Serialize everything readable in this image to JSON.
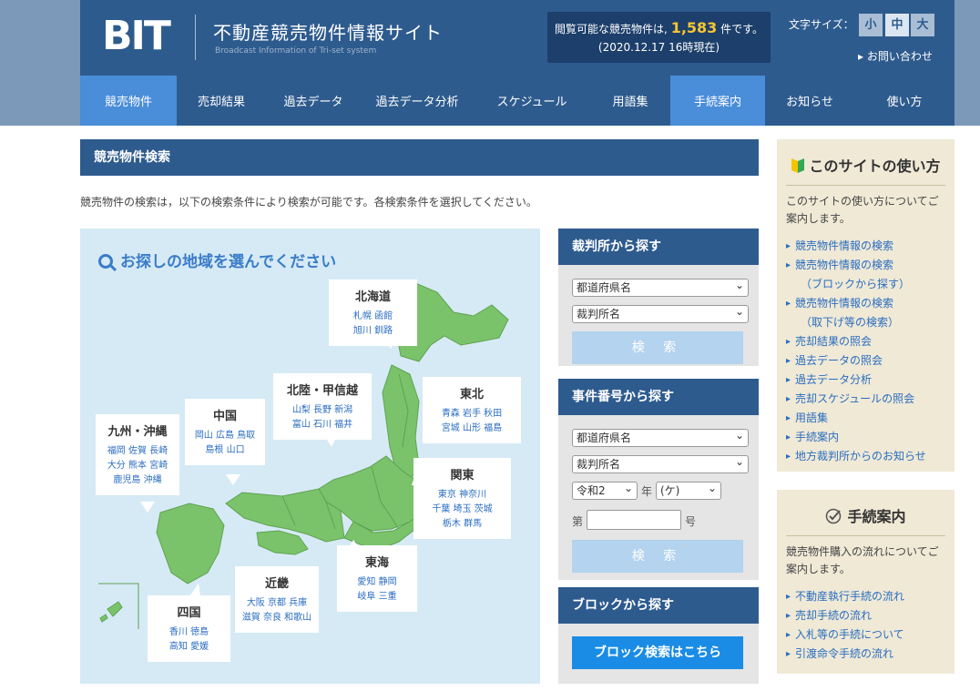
{
  "header": {
    "logo": "BIT",
    "site_title": "不動産競売物件情報サイト",
    "site_subtitle": "Broadcast Information of Tri-set system",
    "count_prefix": "閲覧可能な競売物件は,",
    "count_value": "1,583",
    "count_suffix": "件です。",
    "count_date": "(2020.12.17 16時現在)",
    "font_size_label": "文字サイズ：",
    "font_sizes": [
      "小",
      "中",
      "大"
    ],
    "font_size_selected": "中",
    "contact": "▸ お問い合わせ"
  },
  "nav": {
    "items": [
      "競売物件",
      "売却結果",
      "過去データ",
      "過去データ分析",
      "スケジュール",
      "用語集",
      "手続案内",
      "お知らせ",
      "使い方"
    ],
    "active": [
      "競売物件",
      "手続案内"
    ]
  },
  "main": {
    "section_title": "競売物件検索",
    "intro": "競売物件の検索は，以下の検索条件により検索が可能です。各検索条件を選択してください。",
    "map_title": "お探しの地域を選んでください",
    "regions": [
      {
        "name": "北海道",
        "prefs": [
          "札幌 函館",
          "旭川 釧路"
        ]
      },
      {
        "name": "東北",
        "prefs": [
          "青森 岩手 秋田",
          "宮城 山形 福島"
        ]
      },
      {
        "name": "北陸・甲信越",
        "prefs": [
          "山梨 長野 新潟",
          "富山 石川 福井"
        ]
      },
      {
        "name": "中国",
        "prefs": [
          "岡山 広島 鳥取",
          "島根 山口"
        ]
      },
      {
        "name": "九州・沖縄",
        "prefs": [
          "福岡 佐賀 長崎",
          "大分 熊本 宮崎",
          "鹿児島 沖縄"
        ]
      },
      {
        "name": "関東",
        "prefs": [
          "東京 神奈川",
          "千葉 埼玉 茨城",
          "栃木 群馬"
        ]
      },
      {
        "name": "東海",
        "prefs": [
          "愛知 静岡",
          "岐阜 三重"
        ]
      },
      {
        "name": "近畿",
        "prefs": [
          "大阪 京都 兵庫",
          "滋賀 奈良 和歌山"
        ]
      },
      {
        "name": "四国",
        "prefs": [
          "香川 徳島",
          "高知 愛媛"
        ]
      }
    ]
  },
  "court_search": {
    "title": "裁判所から探す",
    "pref_select": "都道府県名",
    "court_select": "裁判所名",
    "search_button": "検 索"
  },
  "case_search": {
    "title": "事件番号から探す",
    "pref_select": "都道府県名",
    "court_select": "裁判所名",
    "era_select": "令和2",
    "year_label": "年",
    "type_select": "(ケ)",
    "no_prefix": "第",
    "no_suffix": "号",
    "search_button": "検 索"
  },
  "block_search": {
    "title": "ブロックから探す",
    "button": "ブロック検索はこちら"
  },
  "usage_box": {
    "title": "このサイトの使い方",
    "desc": "このサイトの使い方についてご案内します。",
    "links": [
      [
        "競売物件情報の検索"
      ],
      [
        "競売物件情報の検索",
        "（ブロックから探す）"
      ],
      [
        "競売物件情報の検索",
        "（取下げ等の検索）"
      ],
      [
        "売却結果の照会"
      ],
      [
        "過去データの照会"
      ],
      [
        "過去データ分析"
      ],
      [
        "売却スケジュールの照会"
      ],
      [
        "用語集"
      ],
      [
        "手続案内"
      ],
      [
        "地方裁判所からのお知らせ"
      ]
    ]
  },
  "procedure_box": {
    "title": "手続案内",
    "desc": "競売物件購入の流れについてご案内します。",
    "links": [
      "不動産執行手続の流れ",
      "売却手続の流れ",
      "入札等の手続について",
      "引渡命令手続の流れ"
    ]
  },
  "colors": {
    "header_blue": "#2e5b8e",
    "nav_active": "#4a8dd9",
    "map_land": "#7ac36a",
    "map_sea": "#d6eaf5",
    "count_highlight": "#f7c531",
    "link_blue": "#2a6dc0"
  }
}
